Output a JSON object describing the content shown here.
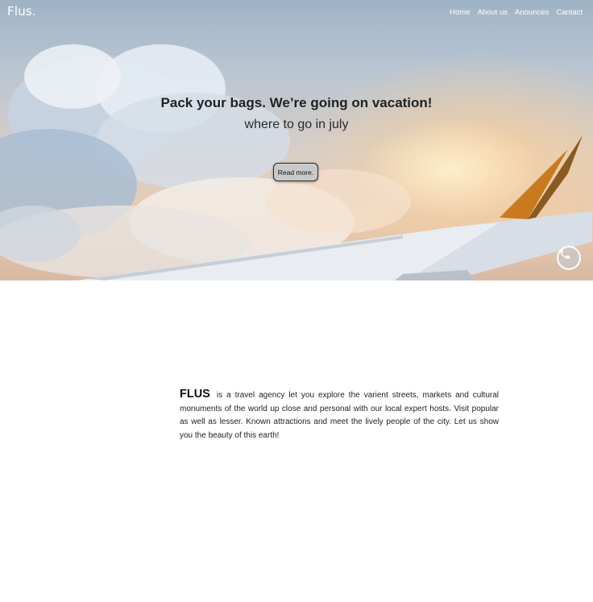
{
  "header": {
    "logo": "Flus.",
    "nav": [
      {
        "label": "Home"
      },
      {
        "label": "About us"
      },
      {
        "label": "Anounces"
      },
      {
        "label": "Cantact"
      }
    ]
  },
  "hero": {
    "headline": "Pack your bags. We’re going on vacation!",
    "subheadline": "where to go in july",
    "cta_label": "Read more."
  },
  "about": {
    "brand": "FLUS",
    "text": "is a travel agency let you explore the varient streets, markets and cultural monuments of the world up close and personal with our local expert hosts. Visit popular as well as lesser. Known attractions and meet the lively people of the city. Let us show you the beauty of this earth!"
  },
  "icons": {
    "chat": "whatsapp-icon"
  },
  "colors": {
    "sky_top": "#9fb3c6",
    "sunset": "#e8cbb0",
    "wing_tip": "#c97a1e",
    "text_dark": "#222222"
  }
}
